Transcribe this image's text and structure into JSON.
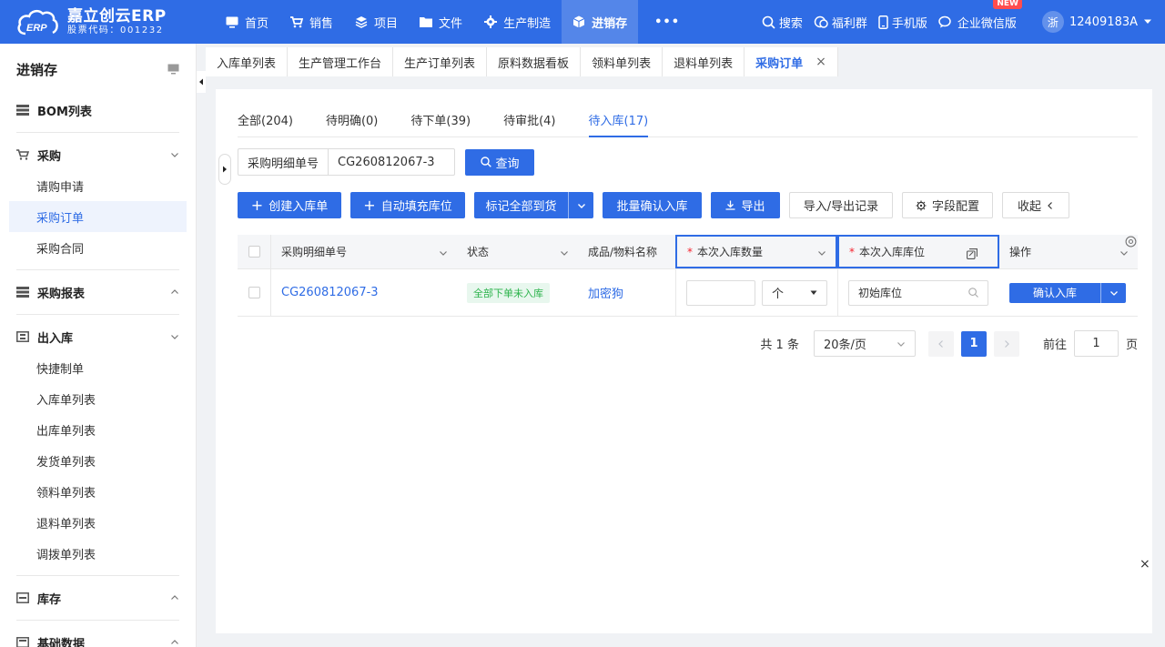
{
  "brand": {
    "title": "嘉立创云ERP",
    "subtitle": "股票代码：001232",
    "accent": "#2f6ce5"
  },
  "topnav": {
    "items": [
      {
        "label": "首页",
        "icon": "monitor-icon"
      },
      {
        "label": "销售",
        "icon": "cart-icon"
      },
      {
        "label": "项目",
        "icon": "layers-icon"
      },
      {
        "label": "文件",
        "icon": "folder-icon"
      },
      {
        "label": "生产制造",
        "icon": "gear-icon"
      },
      {
        "label": "进销存",
        "icon": "box-icon",
        "active": true
      }
    ],
    "more": "•••",
    "search": "搜索",
    "welfare": "福利群",
    "mobile": "手机版",
    "wechat": "企业微信版",
    "new_badge": "NEW",
    "avatar": "浙",
    "user": "12409183A"
  },
  "sidebar": {
    "title": "进销存",
    "bom": "BOM列表",
    "purchase": {
      "label": "采购",
      "items": [
        "请购申请",
        "采购订单",
        "采购合同"
      ]
    },
    "purchase_report": "采购报表",
    "inout": {
      "label": "出入库",
      "items": [
        "快捷制单",
        "入库单列表",
        "出库单列表",
        "发货单列表",
        "领料单列表",
        "退料单列表",
        "调拨单列表"
      ]
    },
    "stock": "库存",
    "basic": "基础数据"
  },
  "tabs": [
    "入库单列表",
    "生产管理工作台",
    "生产订单列表",
    "原料数据看板",
    "领料单列表",
    "退料单列表",
    "采购订单"
  ],
  "tab_close": "×",
  "status_tabs": [
    "全部(204)",
    "待明确(0)",
    "待下单(39)",
    "待审批(4)",
    "待入库(17)"
  ],
  "search": {
    "label": "采购明细单号",
    "value": "CG260812067-3",
    "button": "查询"
  },
  "actions": {
    "create": "创建入库单",
    "autofill": "自动填充库位",
    "mark_all": "标记全部到货",
    "batch_confirm": "批量确认入库",
    "export": "导出",
    "io_record": "导入/导出记录",
    "field_config": "字段配置",
    "collapse": "收起"
  },
  "table": {
    "headers": {
      "no": "采购明细单号",
      "status": "状态",
      "name": "成品/物料名称",
      "qty": "本次入库数量",
      "loc": "本次入库库位",
      "op": "操作"
    },
    "required_mark": "*",
    "rows": [
      {
        "no": "CG260812067-3",
        "status": "全部下单未入库",
        "name": "加密狗",
        "unit": "个",
        "loc": "初始库位",
        "op": "确认入库"
      }
    ]
  },
  "pagination": {
    "total": "共 1 条",
    "size": "20条/页",
    "current": "1",
    "goto_label": "前往",
    "goto_value": "1",
    "page_suffix": "页"
  },
  "float_close": "×"
}
